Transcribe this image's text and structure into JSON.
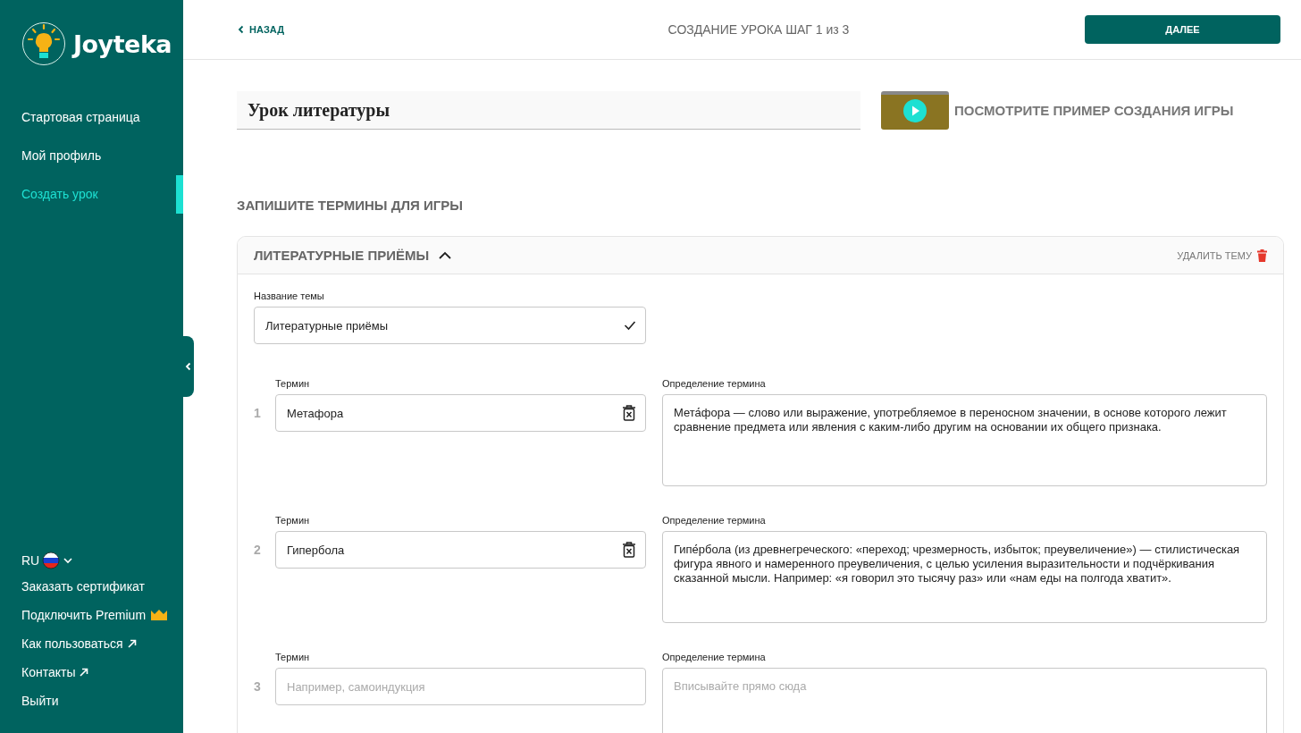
{
  "sidebar": {
    "logo": "Joyteka",
    "items": [
      {
        "label": "Стартовая страница",
        "selected": false
      },
      {
        "label": "Мой профиль",
        "selected": false
      },
      {
        "label": "Создать урок",
        "selected": true
      }
    ],
    "language": "RU",
    "links": [
      {
        "label": "Заказать сертификат",
        "kind": "plain"
      },
      {
        "label": "Подключить Premium",
        "kind": "premium"
      },
      {
        "label": "Как пользоваться",
        "kind": "external"
      },
      {
        "label": "Контакты",
        "kind": "external"
      },
      {
        "label": "Выйти",
        "kind": "plain"
      }
    ]
  },
  "header": {
    "back": "НАЗАД",
    "title": "СОЗДАНИЕ УРОКА ШАГ 1 из 3",
    "next": "ДАЛЕЕ"
  },
  "lesson_title": "Урок литературы",
  "video_link": "ПОСМОТРИТЕ ПРИМЕР СОЗДАНИЯ ИГРЫ",
  "section_title": "ЗАПИШИТЕ ТЕРМИНЫ ДЛЯ ИГРЫ",
  "topic": {
    "title": "ЛИТЕРАТУРНЫЕ ПРИЁМЫ",
    "expanded": true,
    "delete": "УДАЛИТЬ ТЕМУ",
    "name_label": "Название темы",
    "name_value": "Литературные приёмы",
    "terms": [
      {
        "number": "1",
        "term_label": "Термин",
        "term": "Метафора",
        "definition_label": "Определение термина",
        "definition": "Мета́фора — слово или выражение, употребляемое в переносном значении, в основе которого лежит сравнение предмета или явления с каким-либо другим на основании их общего признака."
      },
      {
        "number": "2",
        "term_label": "Термин",
        "term": "Гипербола",
        "definition_label": "Определение термина",
        "definition": "Гипе́рбола (из древнегреческого: «переход; чрезмерность, избыток; преувеличение») — стилистическая фигура явного и намеренного преувеличения, с целью усиления выразительности и подчёркивания сказанной мысли. Например: «я говорил это тысячу раз» или «нам еды на полгода хватит»."
      },
      {
        "number": "3",
        "term_label": "Термин",
        "term_placeholder": "Например, самоиндукция",
        "definition_label": "Определение термина",
        "definition_placeholder": "Вписывайте прямо сюда"
      }
    ]
  }
}
